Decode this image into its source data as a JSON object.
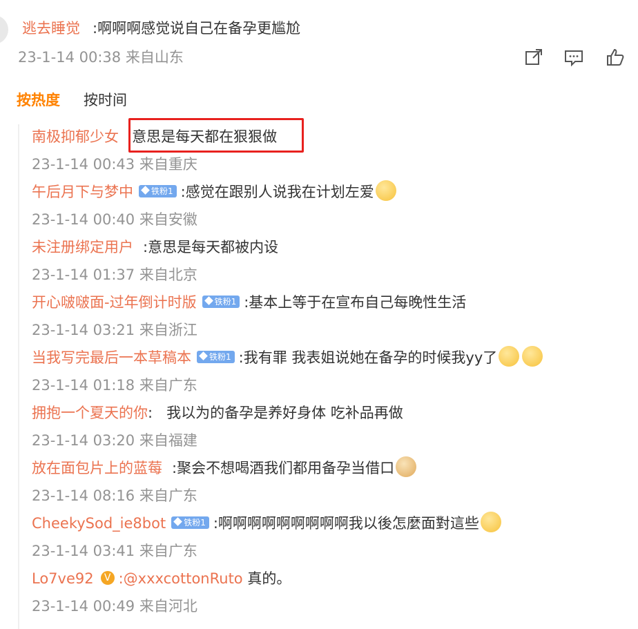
{
  "parent": {
    "username": "逃去睡觉",
    "text": ":啊啊啊感觉说自己在备孕更尴尬",
    "meta": "23-1-14 00:38 来自山东",
    "actions": [
      "share-icon",
      "comment-icon",
      "like-icon"
    ]
  },
  "sort": {
    "hot_label": "按热度",
    "time_label": "按时间"
  },
  "replies": [
    {
      "user": "南极抑郁少女",
      "text": ":意思是每天都在狠狠做",
      "meta": "23-1-14 00:43 来自重庆"
    },
    {
      "user": "午后月下与梦中",
      "badge": "铁粉1",
      "text": ":感觉在跟别人说我在计划左爱",
      "meta": "23-1-14 00:40 来自安徽",
      "emoji": "laugh-cry-emoji"
    },
    {
      "user": "未注册绑定用户",
      "text": ":意思是每天都被内设",
      "meta": "23-1-14 01:37 来自北京"
    },
    {
      "user": "开心啵啵面-过年倒计时版",
      "badge": "铁粉1",
      "text": ":基本上等于在宣布自己每晚性生活",
      "meta": "23-1-14 03:21 来自浙江"
    },
    {
      "user": "当我写完最后一本草稿本",
      "badge": "铁粉1",
      "text": ":我有罪 我表姐说她在备孕的时候我yy了",
      "meta": "23-1-14 01:18 来自广东",
      "emoji": "pleading-emoji"
    },
    {
      "user": "拥抱一个夏天的你",
      "text": ":   我以为的备孕是养好身体 吃补品再做",
      "meta": "23-1-14 03:20 来自福建"
    },
    {
      "user": "放在面包片上的蓝莓",
      "text": ":聚会不想喝酒我们都用备孕当借口",
      "meta": "23-1-14 08:16 来自广东",
      "emoji": "doge-emoji"
    },
    {
      "user": "CheekySod_ie8bot",
      "badge": "铁粉1",
      "text": ":啊啊啊啊啊啊啊啊啊我以後怎麼面對這些",
      "meta": "23-1-14 03:41 来自广东",
      "emoji": "crying-emoji"
    },
    {
      "user": "Lo7ve92",
      "verified": "V",
      "mention": ":@xxxcottonRuto",
      "text": " 真的。",
      "meta": "23-1-14 00:49 来自河北"
    }
  ],
  "colors": {
    "username": "#eb7350",
    "meta": "#939393",
    "active_tab": "#ff8200",
    "highlight": "#e8211e",
    "badge": "#73a8ee"
  }
}
